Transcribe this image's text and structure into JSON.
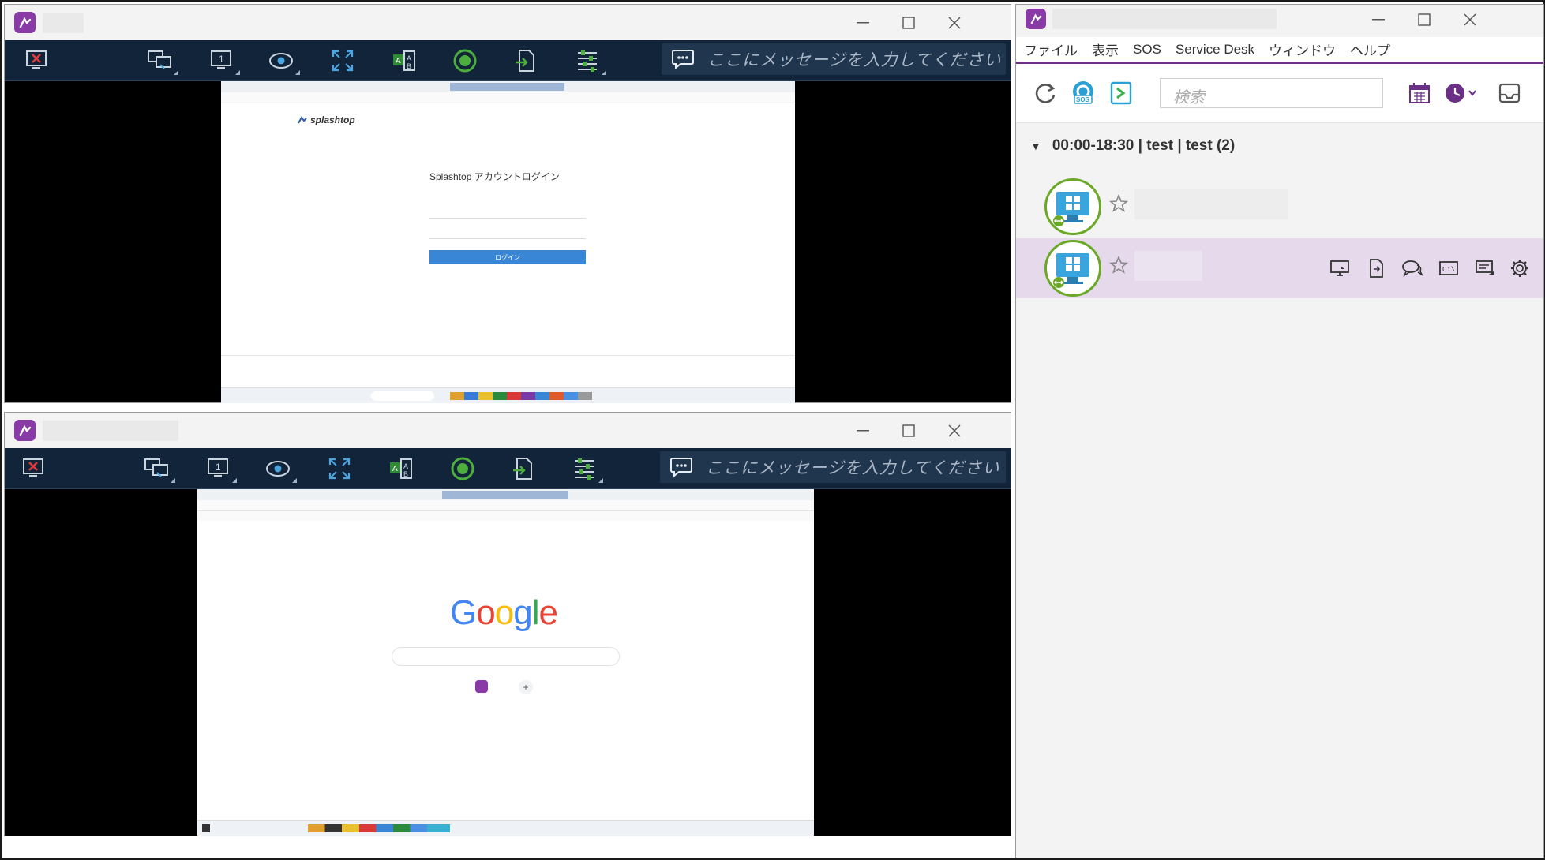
{
  "window_top": {
    "message_placeholder": "ここにメッセージを入力してください",
    "remote_page": {
      "logo_text": "splashtop",
      "login_title": "Splashtop アカウントログイン",
      "login_button": "ログイン"
    }
  },
  "window_bottom": {
    "message_placeholder": "ここにメッセージを入力してください",
    "remote_page": {
      "logo_text": "Google"
    }
  },
  "side_app": {
    "menu": [
      "ファイル",
      "表示",
      "SOS",
      "Service Desk",
      "ウィンドウ",
      "ヘルプ"
    ],
    "search_placeholder": "検索",
    "group_label": "00:00-18:30 | test | test (2)",
    "colors": {
      "accent": "#6b2f86",
      "selected_row": "#e6d9ec",
      "toolbar": "#12243a"
    }
  }
}
